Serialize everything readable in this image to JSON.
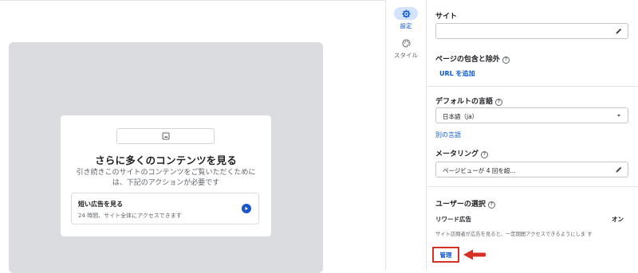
{
  "preview": {
    "card_title": "さらに多くのコンテンツを見る",
    "card_desc_line1": "引き続きこのサイトのコンテンツをご覧いただくために",
    "card_desc_line2": "は、下記のアクションが必要です",
    "ad_option": {
      "title": "短い広告を見る",
      "subtitle": "24 時間、サイト全体にアクセスできます",
      "icon": "play-arrow-icon"
    },
    "image_icon": "image-icon"
  },
  "rail": {
    "items": [
      {
        "label": "設定",
        "icon": "gear-icon",
        "active": true
      },
      {
        "label": "スタイル",
        "icon": "palette-icon",
        "active": false
      }
    ]
  },
  "panel": {
    "site": {
      "title": "サイト",
      "value": "",
      "icon": "pencil-icon"
    },
    "pages": {
      "title": "ページの包含と除外",
      "add_link": "URL を追加"
    },
    "language": {
      "title": "デフォルトの言語",
      "selected": "日本語（ja）",
      "alt_link": "別の言語"
    },
    "metering": {
      "title": "メータリング",
      "value": "ページビューが 4 回を超..."
    },
    "user_choice": {
      "title": "ユーザーの選択",
      "reward_label": "リワード広告",
      "reward_state": "オン",
      "reward_desc": "サイト訪問者が広告を見ると、一定期間アクセスできるようにしま す",
      "manage_label": "管理"
    }
  },
  "colors": {
    "accent": "#0b57d0",
    "highlight": "#d93025",
    "preview_bg": "#dadce0"
  }
}
